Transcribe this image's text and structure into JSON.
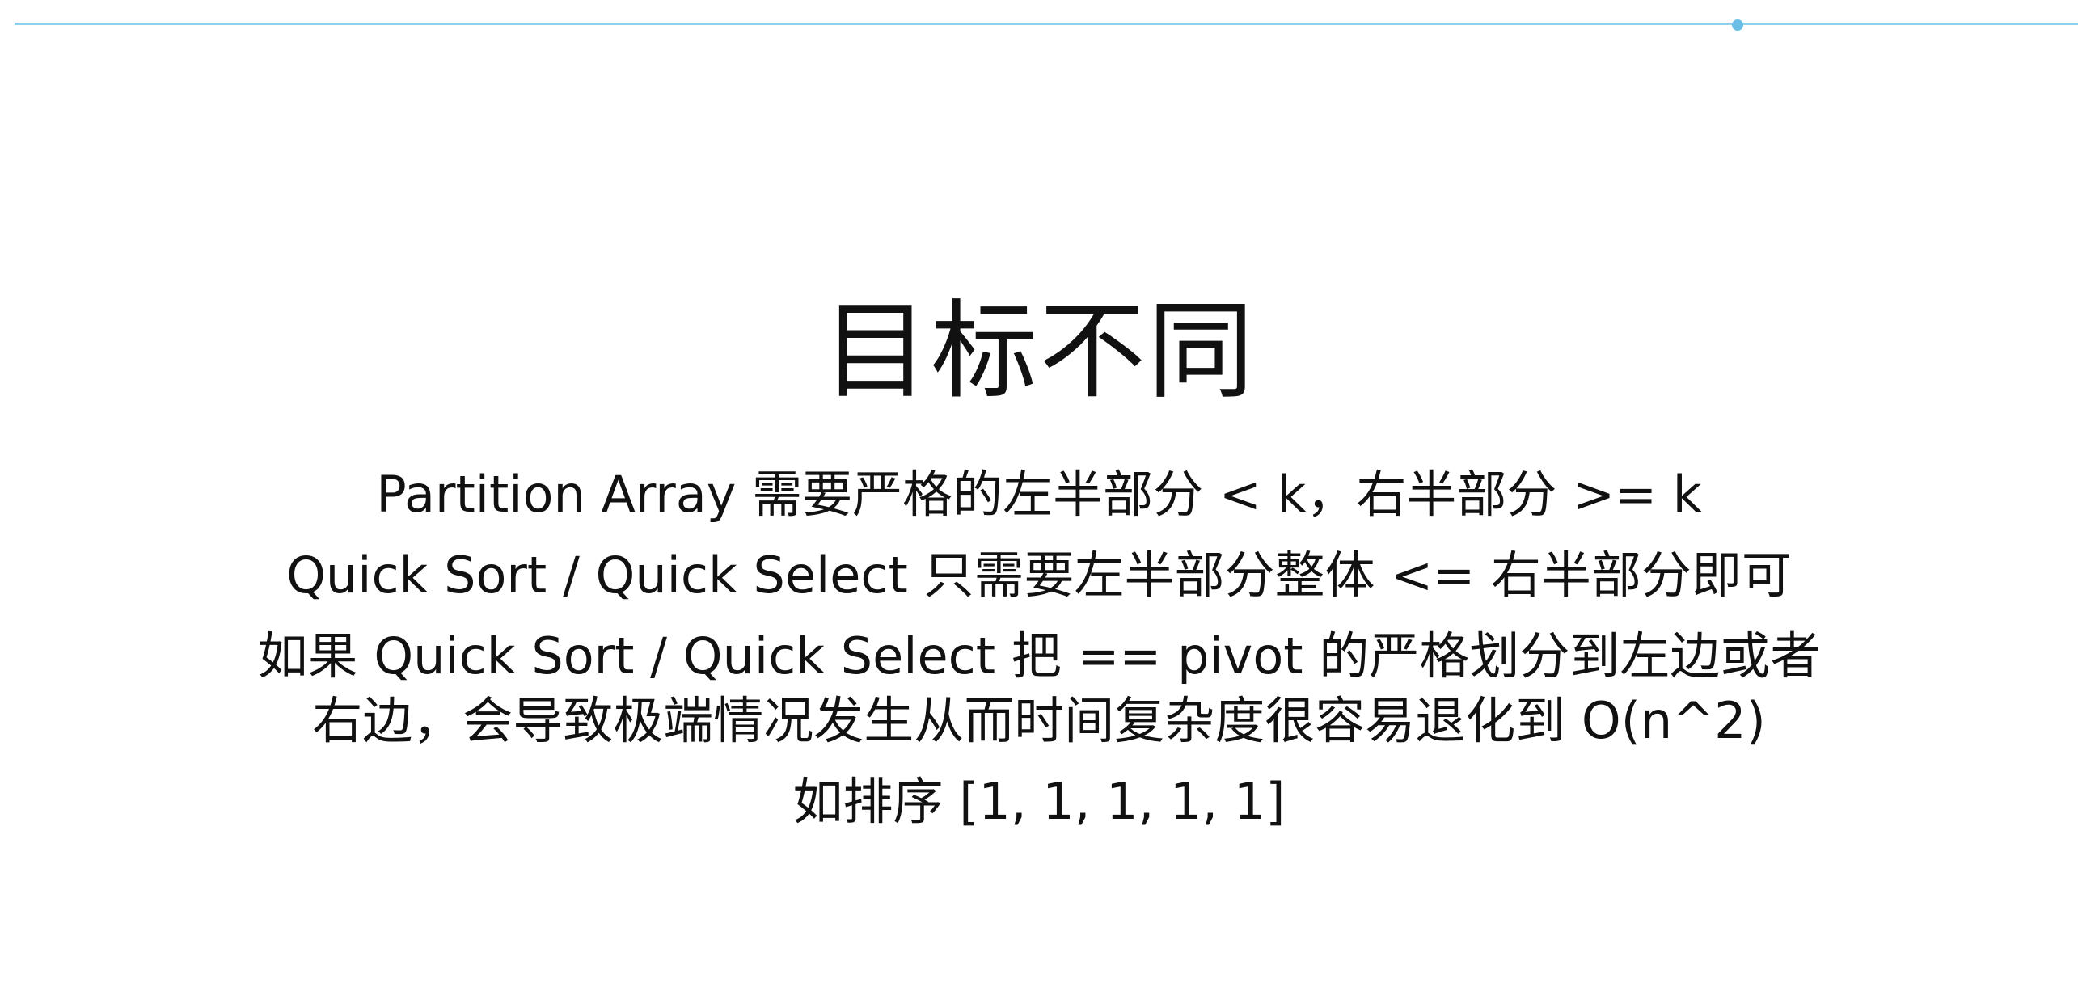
{
  "slide": {
    "title": "目标不同",
    "lines": [
      "Partition Array 需要严格的左半部分 < k，右半部分 >= k",
      "Quick Sort / Quick Select 只需要左半部分整体 <= 右半部分即可",
      "如果 Quick Sort / Quick Select 把 == pivot 的严格划分到左边或者",
      "右边，会导致极端情况发生从而时间复杂度很容易退化到 O(n^2)",
      "如排序 [1, 1, 1, 1, 1]"
    ]
  },
  "colors": {
    "accent_rule": "#8fd0ee",
    "text": "#111111",
    "background": "#ffffff"
  }
}
